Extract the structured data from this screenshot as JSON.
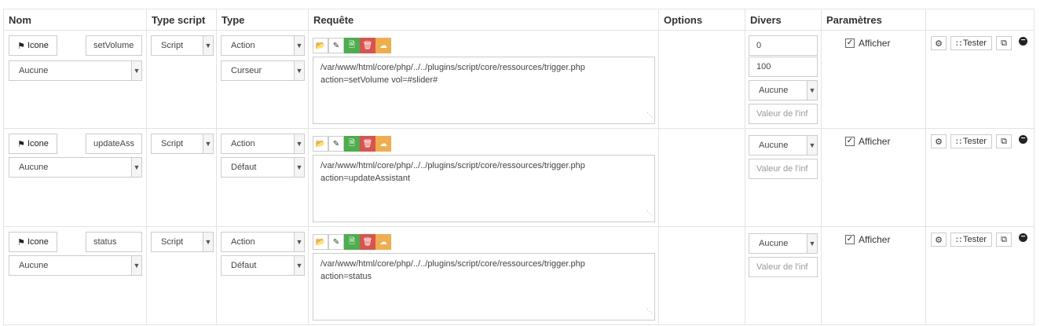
{
  "headers": [
    "Nom",
    "Type script",
    "Type",
    "Requête",
    "Options",
    "Divers",
    "Paramètres",
    ""
  ],
  "common": {
    "icone_label": "Icone",
    "script_type": "Script",
    "afficher_label": "Afficher",
    "tester_label": "Tester",
    "aucune": "Aucune",
    "valeur_placeholder": "Valeur de l'inf"
  },
  "rows": [
    {
      "name": "setVolume",
      "object_select": "Aucune",
      "type": "Action",
      "subtype": "Curseur",
      "request_line1": "/var/www/html/core/php/../../plugins/script/core/ressources/trigger.php",
      "request_line2": "action=setVolume vol=#slider#",
      "min": "0",
      "max": "100",
      "unit_select": "Aucune",
      "afficher_checked": true
    },
    {
      "name": "updateAss",
      "object_select": "Aucune",
      "type": "Action",
      "subtype": "Défaut",
      "request_line1": "/var/www/html/core/php/../../plugins/script/core/ressources/trigger.php",
      "request_line2": "action=updateAssistant",
      "unit_select": "Aucune",
      "afficher_checked": true
    },
    {
      "name": "status",
      "object_select": "Aucune",
      "type": "Action",
      "subtype": "Défaut",
      "request_line1": "/var/www/html/core/php/../../plugins/script/core/ressources/trigger.php",
      "request_line2": "action=status",
      "unit_select": "Aucune",
      "afficher_checked": true
    }
  ],
  "toolbar_icons": [
    "folder-open-icon",
    "edit-icon",
    "new-file-icon",
    "trash-icon",
    "cloud-upload-icon"
  ],
  "colors": {
    "green": "#4cae4c",
    "red": "#d9534f",
    "orange": "#f0ad4e",
    "border": "#e3e3e3"
  }
}
